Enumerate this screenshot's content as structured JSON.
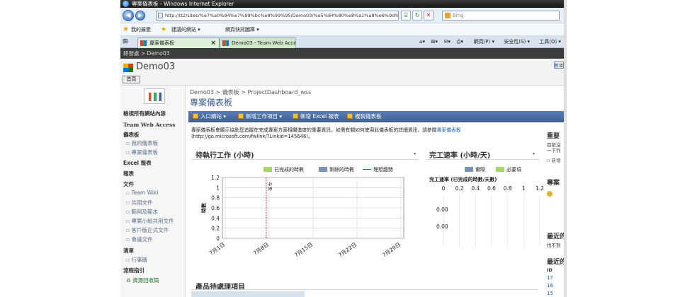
{
  "window": {
    "title": "專案儀表板 - Windows Internet Explorer",
    "url": "http://tt2/sites/%e7%a0%94%e7%99%bc%e8%99%95/Demo03/%e5%84%80%e8%a1%a8%e6%9d%bf/Project",
    "search_placeholder": "Bing"
  },
  "favorites_bar": {
    "favorites_label": "我的最愛",
    "suggested_sites": "建議的網站 ▾",
    "web_slice_gallery": "網頁快訊圖庫 ▾"
  },
  "tabs": [
    {
      "label": "專案儀表板"
    },
    {
      "label": "Demo03 - Team Web Access"
    }
  ],
  "command_bar": {
    "page": "網頁(P) ▾",
    "safety": "安全性(S) ▾",
    "tools": "工具(O) ▾"
  },
  "site": {
    "top_breadcrumb": "研發處 > Demo03",
    "title": "Demo03",
    "home_tab": "首頁",
    "right_link": "新增"
  },
  "leftnav": {
    "view_all": "檢視所有網站內容",
    "twa": "Team Web Access",
    "dashboards_header": "儀表板",
    "dashboards": [
      "我的儀表板",
      "專案儀表板"
    ],
    "excel_header": "Excel 報表",
    "reports_header": "報表",
    "docs_header": "文件",
    "docs": [
      "Team Wiki",
      "共用文件",
      "範例及範本",
      "專案小組共用文件",
      "客戶版正式文件",
      "會議文件"
    ],
    "lists_header": "清單",
    "lists": [
      "行事曆"
    ],
    "process_header": "流程指引",
    "process_link": "資源回收筒"
  },
  "content": {
    "breadcrumb": "Demo03 > 儀表板 > ProjectDashboard_wss",
    "title": "專案儀表板",
    "toolbar": [
      "入口網站 ▾",
      "新增工作項目 ▾",
      "新增 Excel 報表",
      "複製儀表板"
    ],
    "description": "專案儀表板會顯示協助您追蹤在完成專案方面相關進度的重要資訊。如需有關如何使用此儀表板的詳細資訊，請參閱",
    "description_link": "專案儀表板",
    "description_url": "(http://go.microsoft.com/fwlink/?LinkId=145646)。",
    "bottom_title": "產品待處理項目"
  },
  "burndown": {
    "title": "待執行工作 (小時)",
    "menu": "▾",
    "legend": [
      {
        "name": "已完成的時數",
        "color": "#a8d46a"
      },
      {
        "name": "剩餘的時數",
        "color": "#7a93b5"
      },
      {
        "name": "理想趨勢",
        "color": "#e02020"
      }
    ]
  },
  "velocity": {
    "title": "完工速率 (小時/天)",
    "menu": "▾",
    "legend": [
      {
        "name": "實際",
        "color": "#7a93b5"
      },
      {
        "name": "必要項",
        "color": "#a8d46a"
      }
    ]
  },
  "right_col": {
    "heading1": "重要",
    "line1": "目前沒",
    "line2": "一下列",
    "new_link": "新增",
    "heading2": "專案",
    "heading3": "最近的",
    "line3": "找不到",
    "heading4": "最近的",
    "id_header": "ID",
    "ids": [
      "17",
      "16",
      "15"
    ]
  },
  "chart_data": [
    {
      "type": "line",
      "title": "",
      "xlabel": "",
      "ylabel": "時數",
      "categories": [
        "7月1日",
        "7月8日",
        "7月15日",
        "7月22日",
        "7月29日"
      ],
      "ylim": [
        0,
        1.2
      ],
      "yticks": [
        "1.2",
        "1",
        "0.8",
        "0.6",
        "0.4",
        "0.2",
        "0"
      ],
      "series": [],
      "annotations": [
        "今天"
      ],
      "grid": true
    },
    {
      "type": "bar",
      "title": "完工速率 (已完成的時數/天數)",
      "xlabel": "",
      "ylabel": "",
      "xlim": [
        0,
        1.2
      ],
      "xticks": [
        "0",
        "0.2",
        "0.4",
        "0.6",
        "0.8",
        "1",
        "1.2"
      ],
      "values": [
        0.0,
        0.0
      ],
      "value_labels": [
        "0.00",
        "0.00"
      ],
      "grid": true
    }
  ]
}
